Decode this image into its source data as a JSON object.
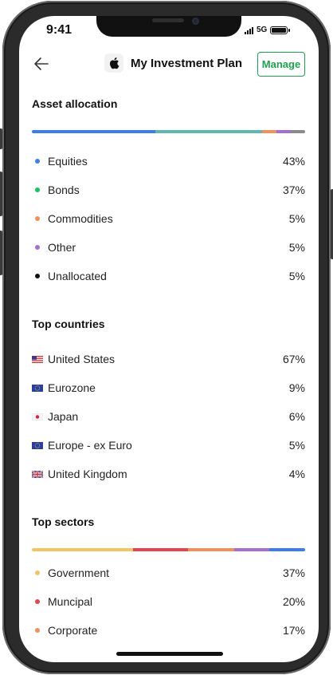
{
  "status_bar": {
    "time": "9:41",
    "network": "5G"
  },
  "header": {
    "title": "My Investment Plan",
    "manage_label": "Manage"
  },
  "asset_allocation": {
    "title": "Asset allocation",
    "items": [
      {
        "label": "Equities",
        "value": "43%",
        "share": 43,
        "color": "#3b7dea"
      },
      {
        "label": "Bonds",
        "value": "37%",
        "share": 37,
        "color": "#14c464"
      },
      {
        "label": "Commodities",
        "value": "5%",
        "share": 5,
        "color": "#f0915a"
      },
      {
        "label": "Other",
        "value": "5%",
        "share": 5,
        "color": "#a56fd0"
      },
      {
        "label": "Unallocated",
        "value": "5%",
        "share": 5,
        "color": "#111111"
      }
    ],
    "bar_colors": [
      "#3b7dea",
      "#5fb8b0",
      "#f0915a",
      "#a56fd0",
      "#8a8a8a"
    ]
  },
  "top_countries": {
    "title": "Top countries",
    "items": [
      {
        "label": "United States",
        "value": "67%",
        "flag": "us-flag"
      },
      {
        "label": "Eurozone",
        "value": "9%",
        "flag": "eu-flag"
      },
      {
        "label": "Japan",
        "value": "6%",
        "flag": "japan-flag"
      },
      {
        "label": "Europe - ex Euro",
        "value": "5%",
        "flag": "eu-flag"
      },
      {
        "label": "United Kingdom",
        "value": "4%",
        "flag": "uk-flag"
      }
    ]
  },
  "top_sectors": {
    "title": "Top sectors",
    "items": [
      {
        "label": "Government",
        "value": "37%",
        "share": 37,
        "color": "#f2c466"
      },
      {
        "label": "Muncipal",
        "value": "20%",
        "share": 20,
        "color": "#e2454f"
      },
      {
        "label": "Corporate",
        "value": "17%",
        "share": 17,
        "color": "#f0915a"
      }
    ],
    "bar_colors": [
      "#f2c466",
      "#e2454f",
      "#f0915a",
      "#a56fd0",
      "#3b7dea"
    ]
  }
}
